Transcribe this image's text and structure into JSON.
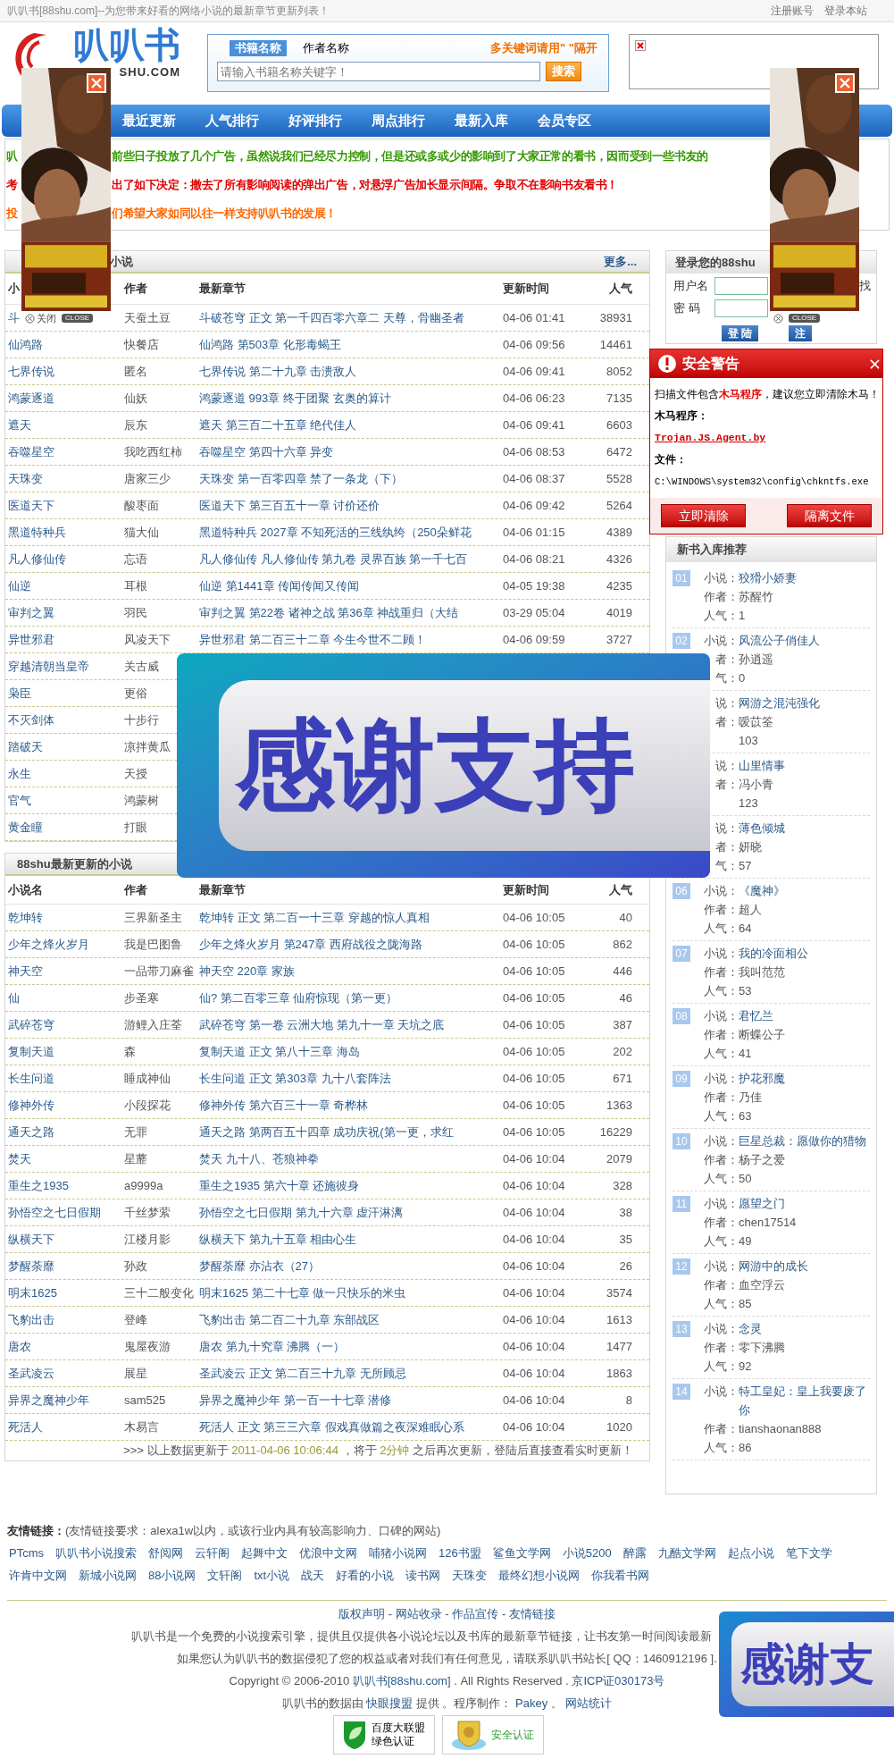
{
  "top_bar": {
    "tagline": "叭叭书[88shu.com]--为您带来好看的网络小说的最新章节更新列表！",
    "links": [
      "注册账号",
      "登录本站"
    ]
  },
  "logo": {
    "name": "叭叭书",
    "domain": "SHU.COM"
  },
  "search": {
    "tabs": [
      {
        "label": "书籍名称",
        "selected": true
      },
      {
        "label": "作者名称",
        "selected": false
      }
    ],
    "hint": "多关键词请用\" \"隔开",
    "placeholder": "请输入书籍名称关键字！",
    "button": "搜索"
  },
  "nav": [
    "最近更新",
    "人气排行",
    "好评排行",
    "周点排行",
    "最新入库",
    "会员专区"
  ],
  "notice": [
    {
      "lead": "叭",
      "text": "前些日子投放了几个广告，虽然说我们已经尽力控制，但是还或多或少的影响到了大家正常的看书，因而受到一些书友的",
      "color": "#339900"
    },
    {
      "lead": "考",
      "text": "出了如下决定：撤去了所有影响阅读的弹出广告，对悬浮广告加长显示间隔。争取不在影响书友看书！",
      "color": "#e00000"
    },
    {
      "lead": "投",
      "text": "们希望大家如同以往一样支持叭叭书的发展！",
      "color": "#ff6600"
    }
  ],
  "ads": [
    {
      "close_text": "关闭",
      "close_badge": "CLOSE"
    },
    {
      "close_badge": "CLOSE"
    }
  ],
  "hot_table": {
    "title": "小说",
    "more": "更多...",
    "columns": [
      "小",
      "作者",
      "最新章节",
      "更新时间",
      "人气"
    ],
    "rows": [
      [
        "斗",
        "天蚕土豆",
        "斗破苍穹 正文 第一千四百零六章二 天尊，骨幽圣者",
        "04-06 01:41",
        "38931"
      ],
      [
        "仙鸿路",
        "快餐店",
        "仙鸿路 第503章 化形毒蝎王",
        "04-06 09:56",
        "14461"
      ],
      [
        "七界传说",
        "匿名",
        "七界传说 第二十九章 击溃敌人",
        "04-06 09:41",
        "8052"
      ],
      [
        "鸿蒙逐道",
        "仙妖",
        "鸿蒙逐道 993章 终于团聚 玄奥的算计",
        "04-06 06:23",
        "7135"
      ],
      [
        "遮天",
        "辰东",
        "遮天 第三百二十五章 绝代佳人",
        "04-06 09:41",
        "6603"
      ],
      [
        "吞噬星空",
        "我吃西红柿",
        "吞噬星空 第四十六章 异变",
        "04-06 08:53",
        "6472"
      ],
      [
        "天珠变",
        "唐家三少",
        "天珠变 第一百零四章 禁了一条龙（下）",
        "04-06 08:37",
        "5528"
      ],
      [
        "医道天下",
        "酸枣面",
        "医道天下 第三百五十一章 讨价还价",
        "04-06 09:42",
        "5264"
      ],
      [
        "黑道特种兵",
        "猫大仙",
        "黑道特种兵 2027章 不知死活的三线纨绔（250朵鲜花",
        "04-06 01:15",
        "4389"
      ],
      [
        "凡人修仙传",
        "忘语",
        "凡人修仙传 凡人修仙传 第九卷 灵界百族 第一千七百",
        "04-06 08:21",
        "4326"
      ],
      [
        "仙逆",
        "耳根",
        "仙逆 第1441章 传闻传闻又传闻",
        "04-05 19:38",
        "4235"
      ],
      [
        "审判之翼",
        "羽民",
        "审判之翼 第22卷 诸神之战 第36章 神战重归（大结",
        "03-29 05:04",
        "4019"
      ],
      [
        "异世邪君",
        "风凌天下",
        "异世邪君 第二百三十二章 今生今世不二顾！",
        "04-06 09:59",
        "3727"
      ],
      [
        "穿越清朝当皇帝",
        "关古威"
      ],
      [
        "枭臣",
        "更俗"
      ],
      [
        "不灭剑体",
        "十步行"
      ],
      [
        "踏破天",
        "凉拌黄瓜"
      ],
      [
        "永生",
        "天授"
      ],
      [
        "官气",
        "鸿蒙树"
      ],
      [
        "黄金瞳",
        "打眼"
      ]
    ]
  },
  "latest_table": {
    "title": "88shu最新更新的小说",
    "columns": [
      "小说名",
      "作者",
      "最新章节",
      "更新时间",
      "人气"
    ],
    "rows": [
      [
        "乾坤转",
        "三界新圣主",
        "乾坤转 正文 第二百一十三章 穿越的惊人真相",
        "04-06 10:05",
        "40"
      ],
      [
        "少年之烽火岁月",
        "我是巴图鲁",
        "少年之烽火岁月 第247章 西府战役之陇海路",
        "04-06 10:05",
        "862"
      ],
      [
        "神天空",
        "一品带刀麻雀",
        "神天空 220章 家族",
        "04-06 10:05",
        "446"
      ],
      [
        "仙",
        "步圣寒",
        "仙? 第二百零三章 仙府惊现（第一更）",
        "04-06 10:05",
        "46"
      ],
      [
        "武碎苍穹",
        "游鲤入庄荃",
        "武碎苍穹 第一卷 云洲大地 第九十一章 天坑之底",
        "04-06 10:05",
        "387"
      ],
      [
        "复制天道",
        "森",
        "复制天道 正文 第八十三章 海岛",
        "04-06 10:05",
        "202"
      ],
      [
        "长生问道",
        "睡成神仙",
        "长生问道 正文 第303章 九十八套阵法",
        "04-06 10:05",
        "671"
      ],
      [
        "修神外传",
        "小段探花",
        "修神外传 第六百三十一章 奇桦林",
        "04-06 10:05",
        "1363"
      ],
      [
        "通天之路",
        "无罪",
        "通天之路 第两百五十四章 成功庆祝(第一更，求红",
        "04-06 10:05",
        "16229"
      ],
      [
        "焚天",
        "星蘼",
        "焚天 九十八、苍狼神拳",
        "04-06 10:04",
        "2079"
      ],
      [
        "重生之1935",
        "a9999a",
        "重生之1935 第六十章 还施彼身",
        "04-06 10:04",
        "328"
      ],
      [
        "孙悟空之七日假期",
        "千丝梦萦",
        "孙悟空之七日假期 第九十六章 虚汗淋漓",
        "04-06 10:04",
        "38"
      ],
      [
        "纵横天下",
        "江楼月影",
        "纵横天下 第九十五章 相由心生",
        "04-06 10:04",
        "35"
      ],
      [
        "梦醒荼靡",
        "孙政",
        "梦醒荼靡 亦沾衣（27）",
        "04-06 10:04",
        "26"
      ],
      [
        "明末1625",
        "三十二般变化",
        "明末1625 第二十七章 做一只快乐的米虫",
        "04-06 10:04",
        "3574"
      ],
      [
        "飞豹出击",
        "登峰",
        "飞豹出击 第二百二十九章 东部战区",
        "04-06 10:04",
        "1613"
      ],
      [
        "唐农",
        "鬼屋夜游",
        "唐农 第九十究章 沸腾（一）",
        "04-06 10:04",
        "1477"
      ],
      [
        "圣武凌云",
        "展星",
        "圣武凌云 正文 第二百三十九章 无所顾忌",
        "04-06 10:04",
        "1863"
      ],
      [
        "异界之魔神少年",
        "sam525",
        "异界之魔神少年 第一百一十七章 潜修",
        "04-06 10:04",
        "8"
      ],
      [
        "死活人",
        "木易言",
        "死活人 正文 第三三六章 假戏真做篇之夜深难眠心系",
        "04-06 10:04",
        "1020"
      ]
    ],
    "footer": [
      {
        "kind": "text",
        "text": ">>> 以上数据更新于 "
      },
      {
        "kind": "highlight",
        "text": "2011-04-06 10:06:44"
      },
      {
        "kind": "text",
        "text": " ，将于 "
      },
      {
        "kind": "highlight",
        "text": "2分钟"
      },
      {
        "kind": "text",
        "text": " 之后再次更新，登陆后直接查看实时更新！"
      }
    ]
  },
  "login": {
    "title": "登录您的88shu",
    "fields": [
      {
        "label": "用户名",
        "side_text": "找"
      },
      {
        "label": "密 码"
      }
    ],
    "buttons": [
      "登 陆",
      "注"
    ]
  },
  "alert": {
    "title": "安全警告",
    "message": "扫描文件包含**木马程序**，建议您立即清除木马！",
    "trojan_label": "木马程序：",
    "trojan": "Trojan.JS.Agent.by",
    "file_label": "文件：",
    "file": "C:\\WINDOWS\\system32\\config\\chkntfs.exe",
    "buttons": [
      "立即清除",
      "隔离文件"
    ]
  },
  "new_books": {
    "title": "新书入库推荐",
    "items": [
      {
        "number": "01",
        "title_label": "小说：",
        "title": "狡猾小娇妻",
        "author_label": "作者：",
        "author": "苏醒竹",
        "pop_label": "人气：",
        "popularity": "1"
      },
      {
        "number": "02",
        "title_label": "小说：",
        "title": "风流公子俏佳人",
        "author_label": "者：",
        "author": "孙逍遥",
        "pop_label": "气：",
        "popularity": "0"
      },
      {
        "title_label": "说：",
        "title": "网游之混沌强化",
        "author_label": "者：",
        "author": "嗳苡筌",
        "popularity": "103"
      },
      {
        "title_label": "说：",
        "title": "山里情事",
        "author_label": "者：",
        "author": "冯小青",
        "popularity": "123"
      },
      {
        "title_label": "说：",
        "title": "薄色倾城",
        "author_label": "者：",
        "author": "妍晓",
        "pop_label": "气：",
        "popularity": "57"
      },
      {
        "number": "06",
        "title_label": "小说：",
        "title": "《魔神》",
        "author_label": "作者：",
        "author": "超人",
        "pop_label": "人气：",
        "popularity": "64"
      },
      {
        "number": "07",
        "title_label": "小说：",
        "title": "我的冷面相公",
        "author_label": "作者：",
        "author": "我叫范范",
        "pop_label": "人气：",
        "popularity": "53"
      },
      {
        "number": "08",
        "title_label": "小说：",
        "title": "君忆兰",
        "author_label": "作者：",
        "author": "断蝶公子",
        "pop_label": "人气：",
        "popularity": "41"
      },
      {
        "number": "09",
        "title_label": "小说：",
        "title": "护花邪魔",
        "author_label": "作者：",
        "author": "乃佳",
        "pop_label": "人气：",
        "popularity": "63"
      },
      {
        "number": "10",
        "title_label": "小说：",
        "title": "巨星总裁：愿做你的猎物",
        "author_label": "作者：",
        "author": "杨子之爱",
        "pop_label": "人气：",
        "popularity": "50"
      },
      {
        "number": "11",
        "title_label": "小说：",
        "title": "愿望之门",
        "author_label": "作者：",
        "author": "chen17514",
        "pop_label": "人气：",
        "popularity": "49"
      },
      {
        "number": "12",
        "title_label": "小说：",
        "title": "网游中的成长",
        "author_label": "作者：",
        "author": "血空浮云",
        "pop_label": "人气：",
        "popularity": "85"
      },
      {
        "number": "13",
        "title_label": "小说：",
        "title": "念灵",
        "author_label": "作者：",
        "author": "零下沸腾",
        "pop_label": "人气：",
        "popularity": "92"
      },
      {
        "number": "14",
        "title_label": "小说：",
        "title": "特工皇妃：皇上我要废了你",
        "author_label": "作者：",
        "author": "tianshaonan888",
        "pop_label": "人气：",
        "popularity": "86"
      }
    ]
  },
  "thanks_banners": [
    {
      "text": "感谢支持"
    },
    {
      "text": "感谢支"
    }
  ],
  "friend_links": {
    "label": "友情链接：",
    "note": "(友情链接要求：alexa1w以内，或该行业内具有较高影响力、口碑的网站)",
    "links": [
      "PTcms",
      "叭叭书小说搜索",
      "舒阅网",
      "云轩阁",
      "起舞中文",
      "优浪中文网",
      "哺猪小说网",
      "126书盟",
      "鲨鱼文学网",
      "小说5200",
      "醉露",
      "九酷文学网",
      "起点小说",
      "笔下文学",
      "许肯中文网",
      "新城小说网",
      "88小说网",
      "文轩阁",
      "txt小说",
      "战天",
      "好看的小说",
      "读书网",
      "天珠变",
      "最终幻想小说网",
      "你我看书网"
    ]
  },
  "footer": {
    "lines": [
      {
        "kind": "centered",
        "parts": [
          {
            "kind": "link",
            "text": "版权声明"
          },
          {
            "kind": "text",
            "text": " - "
          },
          {
            "kind": "link",
            "text": "网站收录"
          },
          {
            "kind": "text",
            "text": " - "
          },
          {
            "kind": "link",
            "text": "作品宣传"
          },
          {
            "kind": "text",
            "text": " - "
          },
          {
            "kind": "link",
            "text": "友情链接"
          }
        ]
      },
      {
        "kind": "clipped",
        "parts": [
          {
            "kind": "text",
            "text": "叭叭书是一个免费的小说搜索引擎，提供且仅提供各小说论坛以及书库的最新章节链接，让书友第一时间阅读最新"
          }
        ]
      },
      {
        "kind": "centered",
        "parts": [
          {
            "kind": "text",
            "text": "如果您认为叭叭书的数据侵犯了您的权益或者对我们有任何意见，请联系叭叭书站长[ QQ：1460912196 ]."
          }
        ]
      },
      {
        "kind": "centered",
        "parts": [
          {
            "kind": "text",
            "text": "Copyright © 2006-2010 "
          },
          {
            "kind": "link",
            "text": "叭叭书[88shu.com]"
          },
          {
            "kind": "text",
            "text": " . All Rights Reserved . "
          },
          {
            "kind": "link",
            "text": "京ICP证030173号"
          }
        ]
      },
      {
        "kind": "centered",
        "parts": [
          {
            "kind": "text",
            "text": "叭叭书的数据由 "
          },
          {
            "kind": "link",
            "text": "快眼搜盟"
          },
          {
            "kind": "text",
            "text": " 提供 。程序制作： "
          },
          {
            "kind": "link",
            "text": "Pakey"
          },
          {
            "kind": "text",
            "text": " 。 "
          },
          {
            "kind": "link",
            "text": "网站统计"
          }
        ]
      }
    ],
    "badges": [
      {
        "kind": "leaf",
        "lines": [
          "百度大联盟",
          "绿色认证"
        ]
      },
      {
        "kind": "shield",
        "lines": [
          "安全认证"
        ]
      }
    ]
  }
}
